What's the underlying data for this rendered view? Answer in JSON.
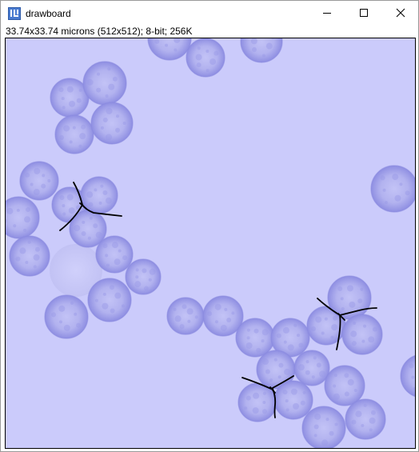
{
  "window": {
    "title": "drawboard",
    "icon": "imagej-icon",
    "controls": [
      "minimize-icon",
      "maximize-icon",
      "close-icon"
    ]
  },
  "image_info": "33.74x33.74 microns (512x512); 8-bit; 256K",
  "canvas": {
    "background_color": "#cbcbfb",
    "cell_fill_color": "#b6b6f2",
    "cell_edge_color": "#8a8ae0",
    "stroke_color": "#000000",
    "annotation_count": 3
  }
}
